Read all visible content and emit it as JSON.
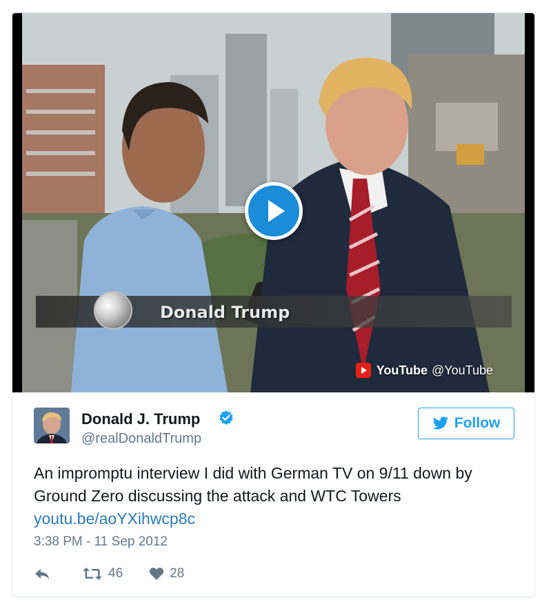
{
  "video": {
    "caption_name": "Donald Trump",
    "watermark_brand": "YouTube",
    "watermark_handle": "@YouTube",
    "play_icon": "play-icon",
    "youtube_icon": "youtube-icon"
  },
  "tweet": {
    "author_name": "Donald J. Trump",
    "handle": "@realDonaldTrump",
    "follow_label": "Follow",
    "text": "An impromptu interview I did with German TV on 9/11 down by Ground Zero discussing the attack and WTC Towers",
    "link": "youtu.be/aoYXihwcp8c",
    "timestamp": "3:38 PM - 11 Sep 2012",
    "retweets": "46",
    "likes": "28"
  },
  "colors": {
    "accent": "#1da1f2",
    "link": "#2b7bb9",
    "muted": "#657786",
    "youtube_red": "#e62117"
  }
}
